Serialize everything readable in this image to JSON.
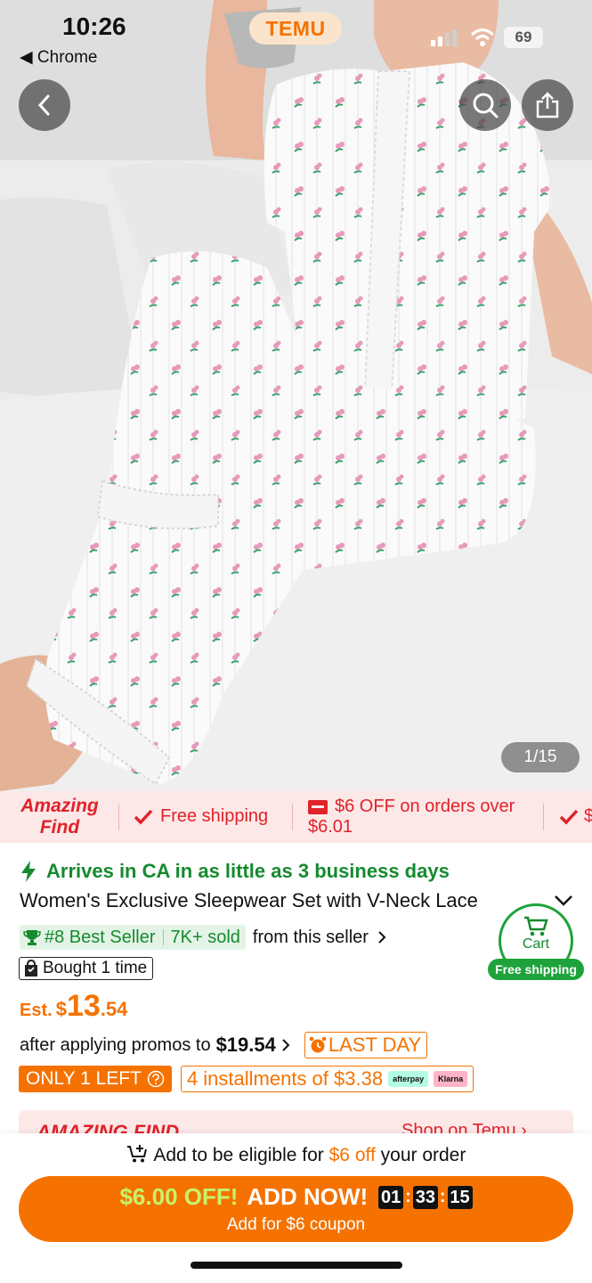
{
  "status_bar": {
    "time": "10:26",
    "back_app": "Chrome",
    "battery": "69"
  },
  "app": {
    "logo": "TEMU"
  },
  "hero": {
    "page_counter": "1/15",
    "back_icon": "chevron-left-icon",
    "search_icon": "search-icon",
    "share_icon": "share-icon"
  },
  "promo_strip": {
    "badge": [
      "Amazing",
      "Find"
    ],
    "items": [
      "Free shipping",
      "$6 OFF on orders over",
      "$6.01"
    ]
  },
  "product": {
    "arrival": "Arrives in CA in as little as 3 business days",
    "title": "Women's Exclusive Sleepwear Set with V-Neck Lace",
    "best_seller": "#8 Best Seller",
    "sold": "7K+ sold",
    "from_seller": "from this seller",
    "bought": "Bought 1 time",
    "price_label": "Est.",
    "currency": "$",
    "price_int": "13",
    "price_dec": ".54",
    "promo_text": "after applying promos to",
    "promo_price": "$19.54",
    "last_day": "LAST DAY",
    "stock": "ONLY 1 LEFT",
    "installments": "4 installments of $3.38",
    "pay_badges": [
      "afterpay",
      "Klarna"
    ]
  },
  "cart": {
    "label": "Cart",
    "free": "Free shipping"
  },
  "banner": {
    "left": "AMAZING FIND",
    "right": "Shop on Temu ›"
  },
  "bottom": {
    "eligible_prefix": "Add to be eligible for",
    "eligible_amount": "$6 off",
    "eligible_suffix": "your order",
    "cta_off": "$6.00 OFF!",
    "cta_add": "ADD NOW!",
    "timer": [
      "01",
      "33",
      "15"
    ],
    "cta_sub": "Add for $6 coupon"
  },
  "colors": {
    "accent": "#f57200",
    "green": "#158a2e",
    "red": "#e0222a"
  }
}
